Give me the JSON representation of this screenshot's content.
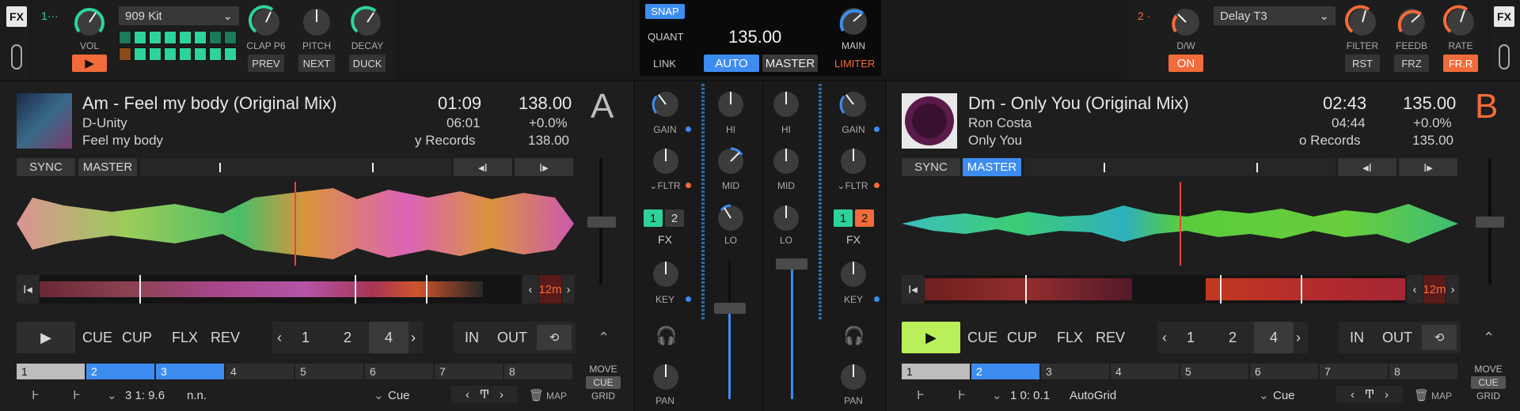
{
  "top": {
    "fx_label_left": "FX",
    "fx_label_right": "FX",
    "left_unit": {
      "unit_number": "1···",
      "kit": "909 Kit",
      "vol_label": "VOL",
      "knobs": [
        "CLAP P6",
        "PITCH",
        "DECAY"
      ],
      "buttons": [
        "PREV",
        "NEXT",
        "DUCK"
      ]
    },
    "center": {
      "snap": "SNAP",
      "quant": "QUANT",
      "bpm": "135.00",
      "main": "MAIN",
      "link": "LINK",
      "auto": "AUTO",
      "master": "MASTER",
      "limiter": "LIMITER"
    },
    "right_unit": {
      "unit_number": "2 ·",
      "effect": "Delay T3",
      "dw_label": "D/W",
      "on": "ON",
      "knobs": [
        "FILTER",
        "FEEDB",
        "RATE"
      ],
      "buttons": [
        "RST",
        "FRZ",
        "FR.R"
      ]
    }
  },
  "colors": {
    "accent_blue": "#3d8cf0",
    "accent_green": "#2ed39a",
    "accent_orange": "#f26b3a",
    "play_green": "#b9f05a"
  },
  "deck_a": {
    "letter": "A",
    "title": "Am - Feel my body  (Original Mix)",
    "artist": "D-Unity",
    "album": "Feel my body",
    "time": "01:09",
    "remaining": "06:01",
    "label": "y Records",
    "bpm": "138.00",
    "pitch": "+0.0%",
    "orig_bpm": "138.00",
    "sync": "SYNC",
    "master": "MASTER",
    "loop_size": "12m",
    "transport": {
      "cue": "CUE",
      "cup": "CUP",
      "flx": "FLX",
      "rev": "REV",
      "in": "IN",
      "out": "OUT"
    },
    "loop_values": [
      "1",
      "2",
      "4"
    ],
    "hotcues": [
      "1",
      "2",
      "3",
      "4",
      "5",
      "6",
      "7",
      "8"
    ],
    "move": "MOVE",
    "move_cue": "CUE",
    "grid": "GRID",
    "position": "3  1: 9.6",
    "key_info": "n.n.",
    "cue_mode": "Cue",
    "map": "MAP"
  },
  "deck_b": {
    "letter": "B",
    "title": "Dm - Only You (Original Mix)",
    "artist": "Ron Costa",
    "album": "Only You",
    "time": "02:43",
    "remaining": "04:44",
    "label": "o Records",
    "bpm": "135.00",
    "pitch": "+0.0%",
    "orig_bpm": "135.00",
    "sync": "SYNC",
    "master": "MASTER",
    "loop_size": "12m",
    "transport": {
      "cue": "CUE",
      "cup": "CUP",
      "flx": "FLX",
      "rev": "REV",
      "in": "IN",
      "out": "OUT"
    },
    "loop_values": [
      "1",
      "2",
      "4"
    ],
    "hotcues": [
      "1",
      "2",
      "3",
      "4",
      "5",
      "6",
      "7",
      "8"
    ],
    "move": "MOVE",
    "move_cue": "CUE",
    "grid": "GRID",
    "position": "1  0: 0.1",
    "key_info": "AutoGrid",
    "cue_mode": "Cue",
    "map": "MAP"
  },
  "mixer": {
    "gain": "GAIN",
    "hi": "HI",
    "mid": "MID",
    "lo": "LO",
    "fltr": "FLTR",
    "fx": "FX",
    "key": "KEY",
    "pan": "PAN",
    "fx1": "1",
    "fx2": "2"
  }
}
